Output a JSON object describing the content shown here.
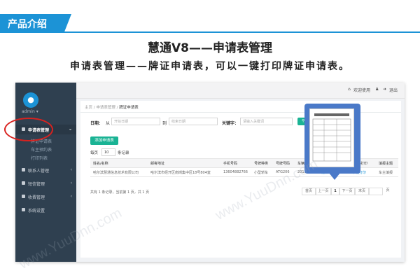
{
  "header": {
    "tag": "产品介绍",
    "title": "慧通V8——申请表管理",
    "subtitle": "申请表管理——牌证申请表，可以一键打印牌证申请表。"
  },
  "sidebar": {
    "user": "admin ▾",
    "items": [
      {
        "label": "申请表管理",
        "active": true
      },
      {
        "label": "联系人管理"
      },
      {
        "label": "短信管理"
      },
      {
        "label": "收費管理"
      },
      {
        "label": "系统设置"
      }
    ],
    "sub_items": [
      "牌证申请表",
      "车主预约表",
      "打印列表"
    ]
  },
  "topbar": {
    "welcome": "欢迎使用",
    "logout": "退出"
  },
  "breadcrumb": {
    "home": "主页",
    "section": "申请表管理",
    "current": "牌证申请表"
  },
  "filter": {
    "date_label": "日期：",
    "from_label": "从",
    "start_placeholder": "开始日期",
    "to_label": "到",
    "end_placeholder": "结束日期",
    "keyword_label": "关键字：",
    "keyword_placeholder": "请输入关键词"
  },
  "add_button": "添加申请表",
  "page_size": {
    "prefix": "每页",
    "value": "10",
    "suffix": "条记录"
  },
  "table": {
    "headers": [
      "姓名/名称",
      "邮寄地址",
      "手机号码",
      "号牌种类",
      "号牌号码",
      "车辆注",
      "",
      "打印",
      "填报主题"
    ],
    "rows": [
      [
        "哈尔滨慧通信息技术有限公司",
        "哈尔滨市经开区南岗集中区18号804室",
        "13604882766",
        "小型轿车",
        "ATG206",
        "2013-01-29",
        "编辑 | 删除",
        "下载打印",
        "车主填报"
      ]
    ]
  },
  "footer_info": "共有 1 条记录，当前第 1 页，共 1 页",
  "pagination": [
    "首页",
    "上一页",
    "1",
    "下一页",
    "末页",
    "页"
  ],
  "watermark": "www.YuuDnn.com",
  "colors": {
    "accent": "#1c93d6",
    "sidebar": "#2f4050",
    "green": "#1ab394",
    "highlight": "#d9221f"
  }
}
